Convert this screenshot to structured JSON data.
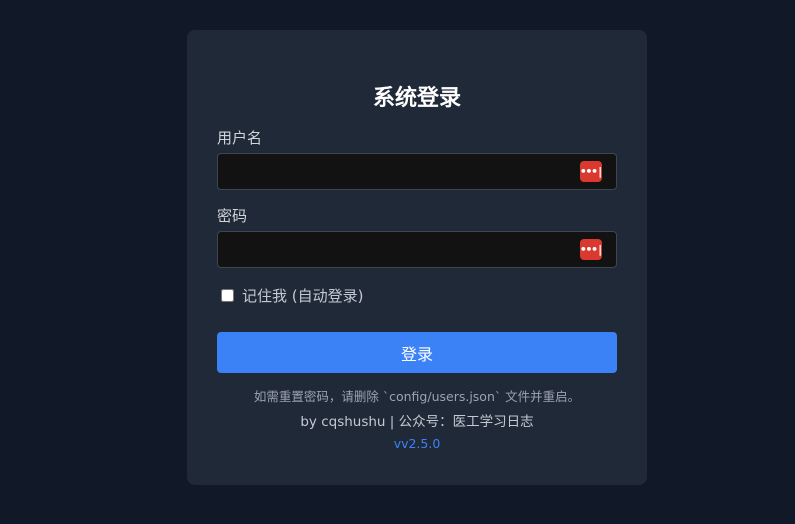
{
  "login": {
    "title": "系统登录",
    "username_label": "用户名",
    "username_value": "",
    "password_label": "密码",
    "password_value": "",
    "password_manager_icon": "•••|",
    "remember_label": "记住我 (自动登录)",
    "remember_checked": false,
    "submit_label": "登录",
    "reset_hint": "如需重置密码，请删除 `config/users.json` 文件并重启。",
    "credit": "by cqshushu | 公众号：医工学习日志",
    "version": "vv2.5.0"
  },
  "colors": {
    "page_background": "#111827",
    "card_background": "#1f2937",
    "accent": "#3b82f6",
    "password_manager": "#d9392f"
  },
  "icons": {
    "field_icon": "password-manager-icon"
  }
}
